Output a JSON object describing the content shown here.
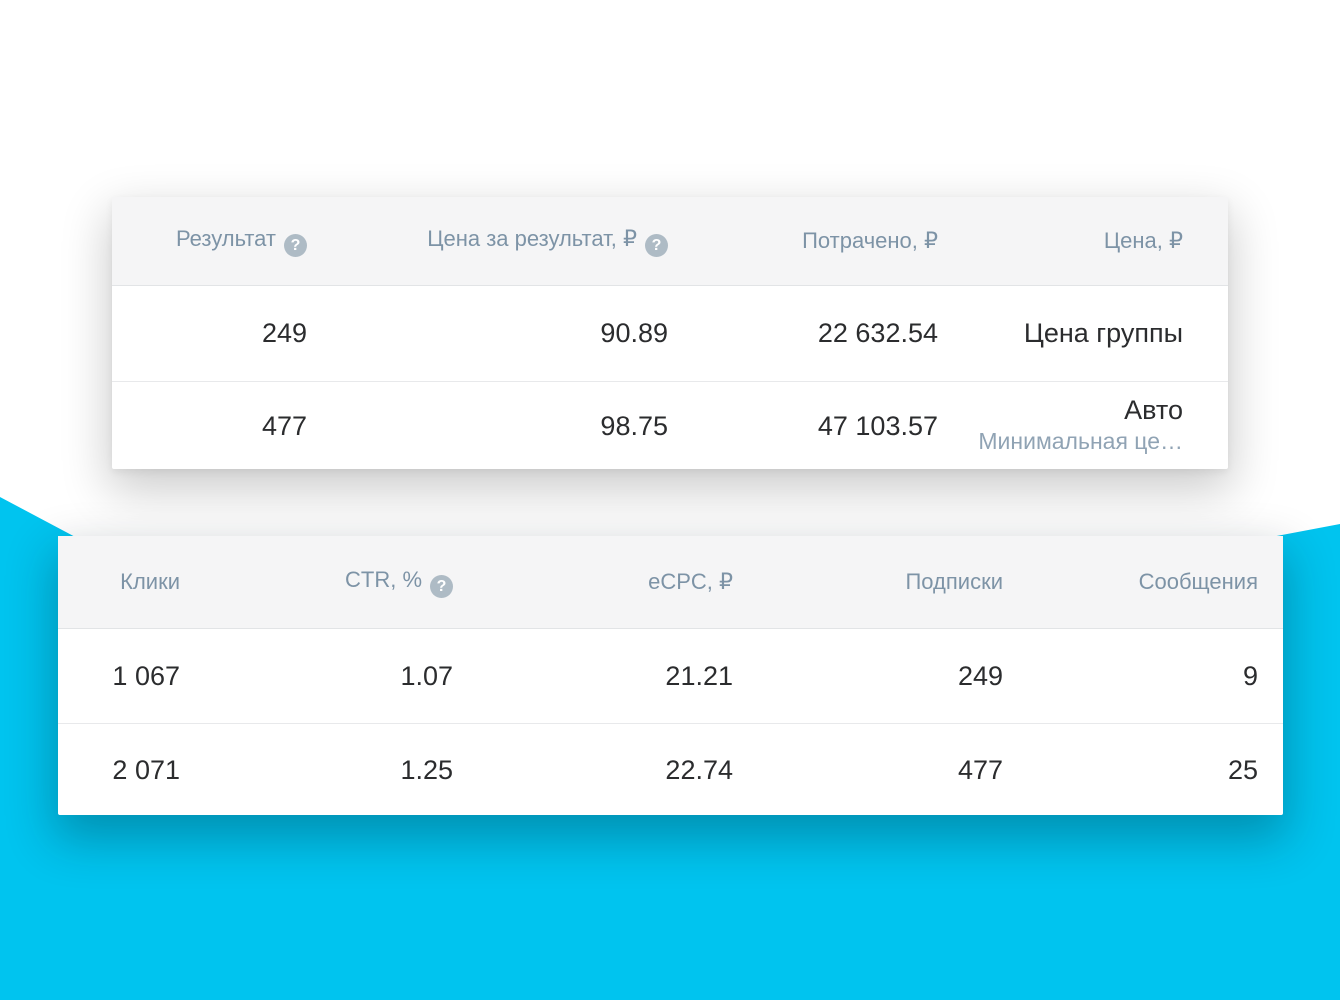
{
  "colors": {
    "accent_cyan": "#00c4ef",
    "header_bg": "#f5f5f6",
    "header_text": "#7d93a6",
    "value_text": "#2b2c2e",
    "muted_text": "#90a3b4"
  },
  "icons": {
    "help_glyph": "?"
  },
  "tables": {
    "top": {
      "columns": [
        "Результат",
        "Цена за результат, ₽",
        "Потрачено, ₽",
        "Цена, ₽"
      ],
      "rows": [
        {
          "result": "249",
          "cost_per_result": "90.89",
          "spent": "22 632.54",
          "price": "Цена группы"
        },
        {
          "result": "477",
          "cost_per_result": "98.75",
          "spent": "47 103.57",
          "price": "Авто",
          "price_note": "Минимальная це…"
        }
      ]
    },
    "bottom": {
      "columns": [
        "Клики",
        "CTR, %",
        "eCPC, ₽",
        "Подписки",
        "Сообщения"
      ],
      "rows": [
        {
          "clicks": "1 067",
          "ctr": "1.07",
          "ecpc": "21.21",
          "subscriptions": "249",
          "messages": "9"
        },
        {
          "clicks": "2 071",
          "ctr": "1.25",
          "ecpc": "22.74",
          "subscriptions": "477",
          "messages": "25"
        }
      ]
    }
  }
}
